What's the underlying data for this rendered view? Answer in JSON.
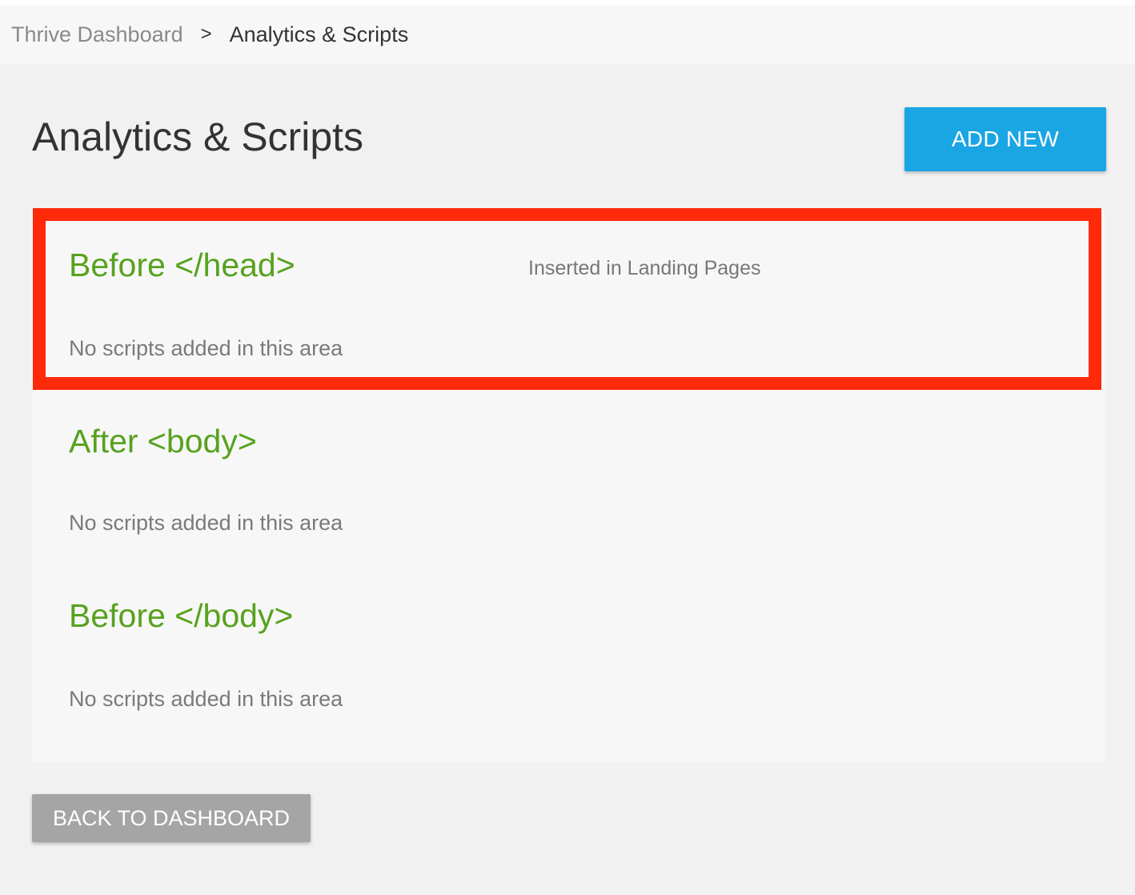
{
  "breadcrumb": {
    "root": "Thrive Dashboard",
    "separator": ">",
    "current": "Analytics & Scripts"
  },
  "page": {
    "title": "Analytics & Scripts",
    "add_new_label": "ADD NEW",
    "back_label": "BACK TO DASHBOARD"
  },
  "sections": [
    {
      "title": "Before </head>",
      "note": "Inserted in Landing Pages",
      "empty_text": "No scripts added in this area"
    },
    {
      "title": "After <body>",
      "empty_text": "No scripts added in this area"
    },
    {
      "title": "Before </body>",
      "empty_text": "No scripts added in this area"
    }
  ],
  "colors": {
    "accent_blue": "#1aa5e3",
    "section_green": "#57a21e",
    "highlight_red": "#ff2a0a",
    "back_button_gray": "#a5a5a5"
  }
}
